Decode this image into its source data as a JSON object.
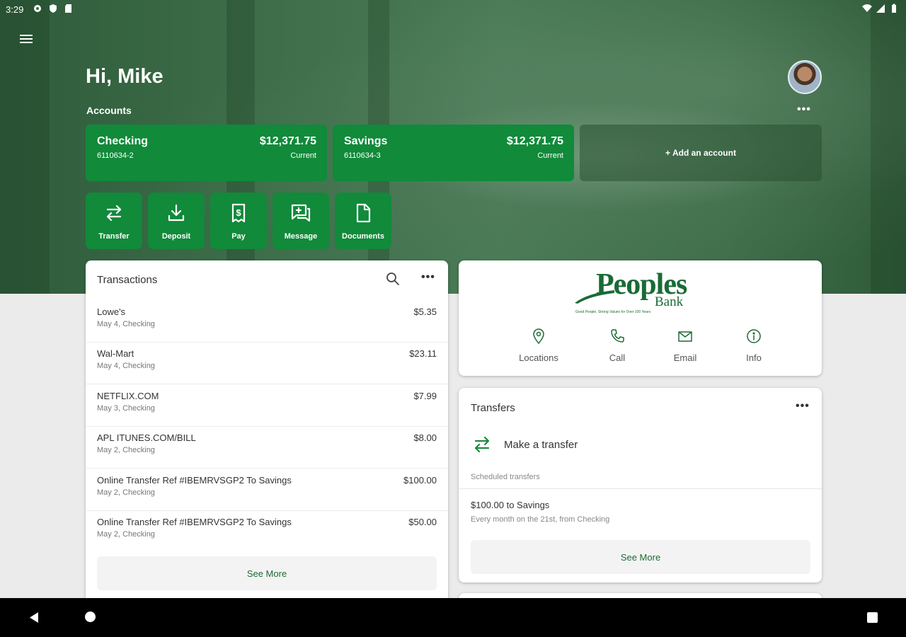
{
  "status_bar": {
    "time": "3:29"
  },
  "header": {
    "greeting": "Hi, Mike",
    "accounts_label": "Accounts",
    "more_label": "•••"
  },
  "accounts": [
    {
      "name": "Checking",
      "number": "6110634-2",
      "balance": "$12,371.75",
      "status": "Current"
    },
    {
      "name": "Savings",
      "number": "6110634-3",
      "balance": "$12,371.75",
      "status": "Current"
    }
  ],
  "add_account": "+ Add an account",
  "actions": [
    {
      "label": "Transfer",
      "icon": "transfer-icon"
    },
    {
      "label": "Deposit",
      "icon": "download-icon"
    },
    {
      "label": "Pay",
      "icon": "bill-icon"
    },
    {
      "label": "Message",
      "icon": "message-icon"
    },
    {
      "label": "Documents",
      "icon": "document-icon"
    }
  ],
  "transactions": {
    "title": "Transactions",
    "more": "•••",
    "rows": [
      {
        "desc": "Lowe's",
        "meta": "May 4, Checking",
        "amount": "$5.35"
      },
      {
        "desc": "Wal-Mart",
        "meta": "May 4, Checking",
        "amount": "$23.11"
      },
      {
        "desc": "NETFLIX.COM",
        "meta": "May 3, Checking",
        "amount": "$7.99"
      },
      {
        "desc": "APL ITUNES.COM/BILL",
        "meta": "May 2, Checking",
        "amount": "$8.00"
      },
      {
        "desc": "Online Transfer Ref #IBEMRVSGP2 To Savings",
        "meta": "May 2, Checking",
        "amount": "$100.00"
      },
      {
        "desc": "Online Transfer Ref #IBEMRVSGP2 To Savings",
        "meta": "May 2, Checking",
        "amount": "$50.00"
      }
    ],
    "see_more": "See More"
  },
  "bank": {
    "logo_main": "Peoples",
    "logo_sub": "Bank",
    "logo_tagline": "Good People, Strong Values for Over 100 Years",
    "links": [
      {
        "label": "Locations",
        "icon": "location-pin-icon"
      },
      {
        "label": "Call",
        "icon": "phone-icon"
      },
      {
        "label": "Email",
        "icon": "email-icon"
      },
      {
        "label": "Info",
        "icon": "info-icon"
      }
    ]
  },
  "transfers": {
    "title": "Transfers",
    "more": "•••",
    "make_transfer": "Make a transfer",
    "scheduled_label": "Scheduled transfers",
    "scheduled_amount": "$100.00 to Savings",
    "scheduled_freq": "Every month on the 21st, from Checking",
    "see_more": "See More"
  },
  "colors": {
    "brand_green": "#118a3a",
    "logo_green": "#1a6b36",
    "hero_green": "#3e6e4a"
  }
}
